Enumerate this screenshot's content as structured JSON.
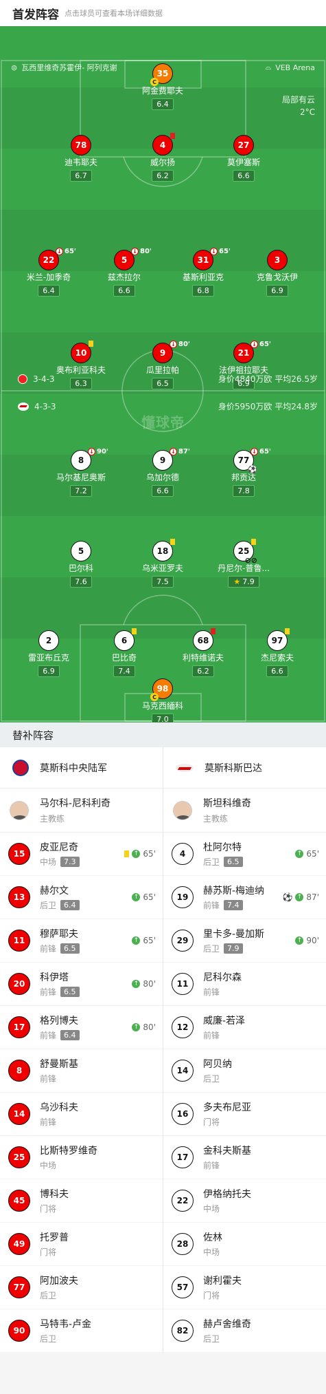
{
  "header": {
    "title": "首发阵容",
    "subtitle": "点击球员可查看本场详细数据"
  },
  "venue": {
    "referee": "瓦西里维奇苏霍伊- 阿列克谢",
    "stadium": "VEB Arena"
  },
  "weather": {
    "desc": "局部有云",
    "temp": "2°C"
  },
  "watermark": "懂球帝",
  "home_team": {
    "formation": "3-4-3",
    "value": "身价4840万欧",
    "avg_age": "平均26.5岁"
  },
  "away_team": {
    "formation": "4-3-3",
    "value": "身价5950万欧",
    "avg_age": "平均24.8岁"
  },
  "home_players": [
    {
      "num": "35",
      "name": "阿金费耶夫",
      "rating": "6.4",
      "captain": "C"
    },
    {
      "num": "78",
      "name": "迪韦耶夫",
      "rating": "6.7"
    },
    {
      "num": "4",
      "name": "威尔扬",
      "rating": "6.2"
    },
    {
      "num": "27",
      "name": "莫伊塞斯",
      "rating": "6.6"
    },
    {
      "num": "22",
      "name": "米兰-加季奇",
      "rating": "6.4",
      "sub": "65'"
    },
    {
      "num": "5",
      "name": "兹杰拉尔",
      "rating": "6.6",
      "sub": "80'"
    },
    {
      "num": "31",
      "name": "基斯利亚克",
      "rating": "6.8",
      "sub": "65'"
    },
    {
      "num": "3",
      "name": "克鲁戈沃伊",
      "rating": "6.9"
    },
    {
      "num": "10",
      "name": "奥布利亚科夫",
      "rating": "6.3"
    },
    {
      "num": "9",
      "name": "瓜里拉帕",
      "rating": "6.5",
      "sub": "80'"
    },
    {
      "num": "21",
      "name": "法伊祖拉耶夫",
      "rating": "6.9",
      "sub": "65'"
    }
  ],
  "away_players": [
    {
      "num": "8",
      "name": "马尔基尼奥斯",
      "rating": "7.2",
      "sub": "90'"
    },
    {
      "num": "9",
      "name": "乌加尔德",
      "rating": "6.6",
      "sub": "87'"
    },
    {
      "num": "77",
      "name": "邦贡达",
      "rating": "7.8",
      "sub": "65'"
    },
    {
      "num": "5",
      "name": "巴尔科",
      "rating": "7.6"
    },
    {
      "num": "18",
      "name": "乌米亚罗夫",
      "rating": "7.5"
    },
    {
      "num": "25",
      "name": "丹尼尔-普鲁...",
      "rating": "7.9"
    },
    {
      "num": "2",
      "name": "雷亚布丘克",
      "rating": "6.9"
    },
    {
      "num": "6",
      "name": "巴比奇",
      "rating": "7.4"
    },
    {
      "num": "68",
      "name": "利特维诺夫",
      "rating": "6.2"
    },
    {
      "num": "97",
      "name": "杰尼索夫",
      "rating": "6.6"
    },
    {
      "num": "98",
      "name": "马克西緬科",
      "rating": "7.0",
      "captain": "C"
    }
  ],
  "subs_section": {
    "title": "替补阵容"
  },
  "home_bench": {
    "team": "莫斯科中央陆军",
    "coach": {
      "name": "马尔科-尼科利奇",
      "role": "主教练"
    },
    "players": [
      {
        "num": "15",
        "name": "皮亚尼奇",
        "pos": "中场",
        "rating": "7.3",
        "yellow": true,
        "in": "65'"
      },
      {
        "num": "13",
        "name": "赫尔文",
        "pos": "后卫",
        "rating": "6.4",
        "in": "65'"
      },
      {
        "num": "11",
        "name": "穆萨耶夫",
        "pos": "前锋",
        "rating": "6.5",
        "in": "65'"
      },
      {
        "num": "20",
        "name": "科伊塔",
        "pos": "前锋",
        "rating": "6.5",
        "in": "80'"
      },
      {
        "num": "17",
        "name": "格列博夫",
        "pos": "前锋",
        "rating": "6.4",
        "in": "80'"
      },
      {
        "num": "8",
        "name": "舒曼斯基",
        "pos": "前锋"
      },
      {
        "num": "14",
        "name": "乌沙科夫",
        "pos": "前锋"
      },
      {
        "num": "25",
        "name": "比斯特罗维奇",
        "pos": "中场"
      },
      {
        "num": "45",
        "name": "博科夫",
        "pos": "门将"
      },
      {
        "num": "49",
        "name": "托罗普",
        "pos": "门将"
      },
      {
        "num": "77",
        "name": "阿加波夫",
        "pos": "后卫"
      },
      {
        "num": "90",
        "name": "马特韦-卢金",
        "pos": "后卫"
      }
    ]
  },
  "away_bench": {
    "team": "莫斯科斯巴达",
    "coach": {
      "name": "斯坦科维奇",
      "role": "主教练"
    },
    "players": [
      {
        "num": "4",
        "name": "杜阿尔特",
        "pos": "后卫",
        "rating": "6.5",
        "in": "65'"
      },
      {
        "num": "19",
        "name": "赫苏斯-梅迪纳",
        "pos": "前锋",
        "rating": "7.4",
        "goal": true,
        "in": "87'"
      },
      {
        "num": "29",
        "name": "里卡多-曼加斯",
        "pos": "后卫",
        "rating": "7.9",
        "in": "90'"
      },
      {
        "num": "11",
        "name": "尼科尔森",
        "pos": "前锋"
      },
      {
        "num": "12",
        "name": "威廉-若泽",
        "pos": "前锋"
      },
      {
        "num": "14",
        "name": "阿贝纳",
        "pos": "后卫"
      },
      {
        "num": "16",
        "name": "多夫布尼亚",
        "pos": "门将"
      },
      {
        "num": "17",
        "name": "金科夫斯基",
        "pos": "前锋"
      },
      {
        "num": "22",
        "name": "伊格纳托夫",
        "pos": "中场"
      },
      {
        "num": "28",
        "name": "佐林",
        "pos": "中场"
      },
      {
        "num": "57",
        "name": "谢利霍夫",
        "pos": "门将"
      },
      {
        "num": "82",
        "name": "赫卢舍维奇",
        "pos": "后卫"
      }
    ]
  }
}
